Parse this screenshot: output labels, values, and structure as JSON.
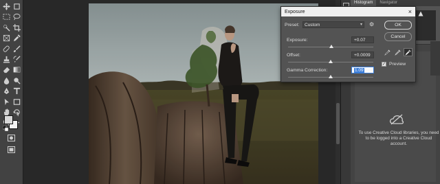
{
  "exposure_dialog": {
    "title": "Exposure",
    "preset_label": "Preset:",
    "preset_value": "Custom",
    "exposure_label": "Exposure:",
    "exposure_value": "+0.07",
    "exposure_level": 0.51,
    "offset_label": "Offset:",
    "offset_value": "+0.0009",
    "offset_level": 0.5,
    "gamma_label": "Gamma Correction:",
    "gamma_value": "1.09",
    "gamma_level": 0.5,
    "ok_label": "OK",
    "cancel_label": "Cancel",
    "preview_label": "Preview",
    "preview_checked": true
  },
  "panels": {
    "tab_histogram": "Histogram",
    "tab_navigator": "Navigator",
    "cc_message_line1": "To use Creative Cloud libraries, you need",
    "cc_message_line2": "to be logged into a Creative Cloud",
    "cc_message_line3": "account."
  },
  "colors": {
    "foreground": "#d9d9d9",
    "background": "#f2f2f2",
    "accent": "#3b7dd8"
  },
  "tools": [
    "move-icon",
    "artboard-icon",
    "marquee-icon",
    "lasso-icon",
    "quick-select-icon",
    "crop-icon",
    "frame-icon",
    "eyedropper-icon",
    "healing-icon",
    "brush-icon",
    "stamp-icon",
    "history-brush-icon",
    "eraser-icon",
    "gradient-icon",
    "blur-icon",
    "dodge-icon",
    "pen-icon",
    "type-icon",
    "path-select-icon",
    "shape-icon",
    "hand-icon",
    "rotate-view-icon",
    "zoom-icon",
    "more-icon"
  ]
}
